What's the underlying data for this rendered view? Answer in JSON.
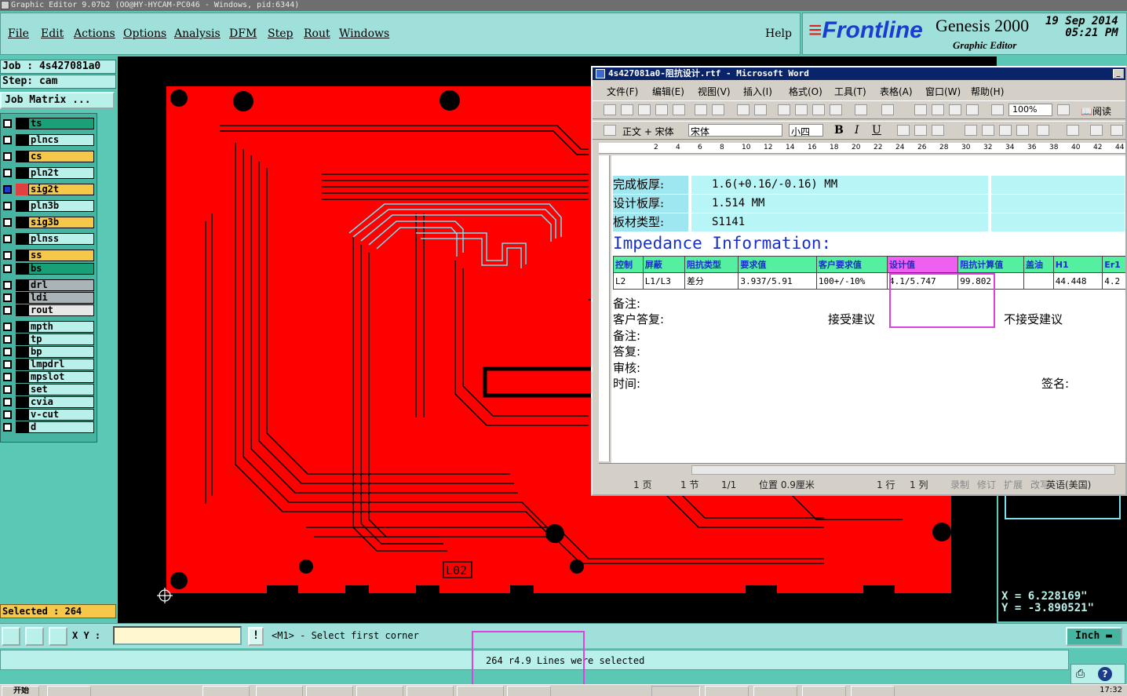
{
  "window": {
    "title": "Graphic Editor 9.07b2 (OO@HY-HYCAM-PC046 - Windows, pid:6344)"
  },
  "menu": [
    "File",
    "Edit",
    "Actions",
    "Options",
    "Analysis",
    "DFM",
    "Step",
    "Rout",
    "Windows"
  ],
  "help": "Help",
  "brand": {
    "logo": "Frontline",
    "product": "Genesis 2000",
    "subtitle": "Graphic Editor",
    "date": "19 Sep 2014",
    "time": "05:21 PM"
  },
  "job": {
    "job": "Job : 4s427081a0",
    "step": "Step: cam",
    "matrix_button": "Job Matrix ..."
  },
  "layers": [
    {
      "name": "ts",
      "color": "#1aa078"
    },
    {
      "name": "plncs",
      "color": "#b9f0ea"
    },
    {
      "name": "cs",
      "color": "#f5c84a"
    },
    {
      "name": "pln2t",
      "color": "#b9f0ea"
    },
    {
      "name": "sig2t",
      "color": "#f5c84a"
    },
    {
      "name": "pln3b",
      "color": "#b9f0ea"
    },
    {
      "name": "sig3b",
      "color": "#f5c84a"
    },
    {
      "name": "plnss",
      "color": "#b9f0ea"
    },
    {
      "name": "ss",
      "color": "#f5c84a"
    },
    {
      "name": "bs",
      "color": "#1aa078"
    },
    {
      "name": "drl",
      "color": "#a8b4b8"
    },
    {
      "name": "ldi",
      "color": "#a8b4b8"
    },
    {
      "name": "rout",
      "color": "#e8e8e8"
    },
    {
      "name": "mpth",
      "color": "#b9f0ea"
    },
    {
      "name": "tp",
      "color": "#b9f0ea"
    },
    {
      "name": "bp",
      "color": "#b9f0ea"
    },
    {
      "name": "lmpdrl",
      "color": "#b9f0ea"
    },
    {
      "name": "mpslot",
      "color": "#b9f0ea"
    },
    {
      "name": "set",
      "color": "#b9f0ea"
    },
    {
      "name": "cvia",
      "color": "#b9f0ea"
    },
    {
      "name": "v-cut",
      "color": "#b9f0ea"
    },
    {
      "name": "d",
      "color": "#b9f0ea"
    }
  ],
  "selected": "Selected : 264",
  "board_label": "L02",
  "coords": {
    "x": "X = 6.228169\"",
    "y": "Y = -3.890521\""
  },
  "cmd": {
    "xy_label": "X Y :",
    "xy_value": "",
    "bang": "!",
    "prompt": "<M1> - Select first corner",
    "units": "Inch"
  },
  "status": "264 r4.9 Lines were selected",
  "word": {
    "title": "4s427081a0-阻抗设计.rtf - Microsoft Word",
    "menu": [
      "文件(F)",
      "编辑(E)",
      "视图(V)",
      "插入(I)",
      "格式(O)",
      "工具(T)",
      "表格(A)",
      "窗口(W)",
      "帮助(H)"
    ],
    "zoom": "100%",
    "read_label": "阅读",
    "style": "正文 + 宋体",
    "font": "宋体",
    "size": "小四",
    "ruler_ticks": [
      "2",
      "4",
      "6",
      "8",
      "10",
      "12",
      "14",
      "16",
      "18",
      "20",
      "22",
      "24",
      "26",
      "28",
      "30",
      "32",
      "34",
      "36",
      "38",
      "40",
      "42",
      "44"
    ],
    "props": [
      {
        "k": "完成板厚:",
        "v": "1.6(+0.16/-0.16) MM"
      },
      {
        "k": "设计板厚:",
        "v": "1.514 MM"
      },
      {
        "k": "板材类型:",
        "v": "S1141"
      }
    ],
    "imp_title": "Impedance Information:",
    "headers": [
      "控制",
      "屏蔽",
      "阻抗类型",
      "要求值",
      "客户要求值",
      "设计值",
      "阻抗计算值",
      "盖油",
      "H1",
      "Er1"
    ],
    "row": [
      "L2",
      "L1/L3",
      "差分",
      "3.937/5.91",
      "100+/-10%",
      "4.1/5.747",
      "99.802",
      "",
      "44.448",
      "4.2"
    ],
    "notes": {
      "remark1": "备注:",
      "reply_label": "客户答复:",
      "accept": "接受建议",
      "reject": "不接受建议",
      "remark2": "备注:",
      "answer": "答复:",
      "review": "审核:",
      "time": "时间:",
      "sign": "签名:"
    },
    "status": {
      "page": "1 页",
      "section": "1 节",
      "pages": "1/1",
      "pos": "位置 0.9厘米",
      "line": "1 行",
      "col": "1 列",
      "rec": "录制",
      "trk": "修订",
      "ext": "扩展",
      "ovr": "改写",
      "lang": "英语(美国)"
    }
  },
  "taskbar": {
    "start": "开始",
    "clock": "17:32"
  }
}
